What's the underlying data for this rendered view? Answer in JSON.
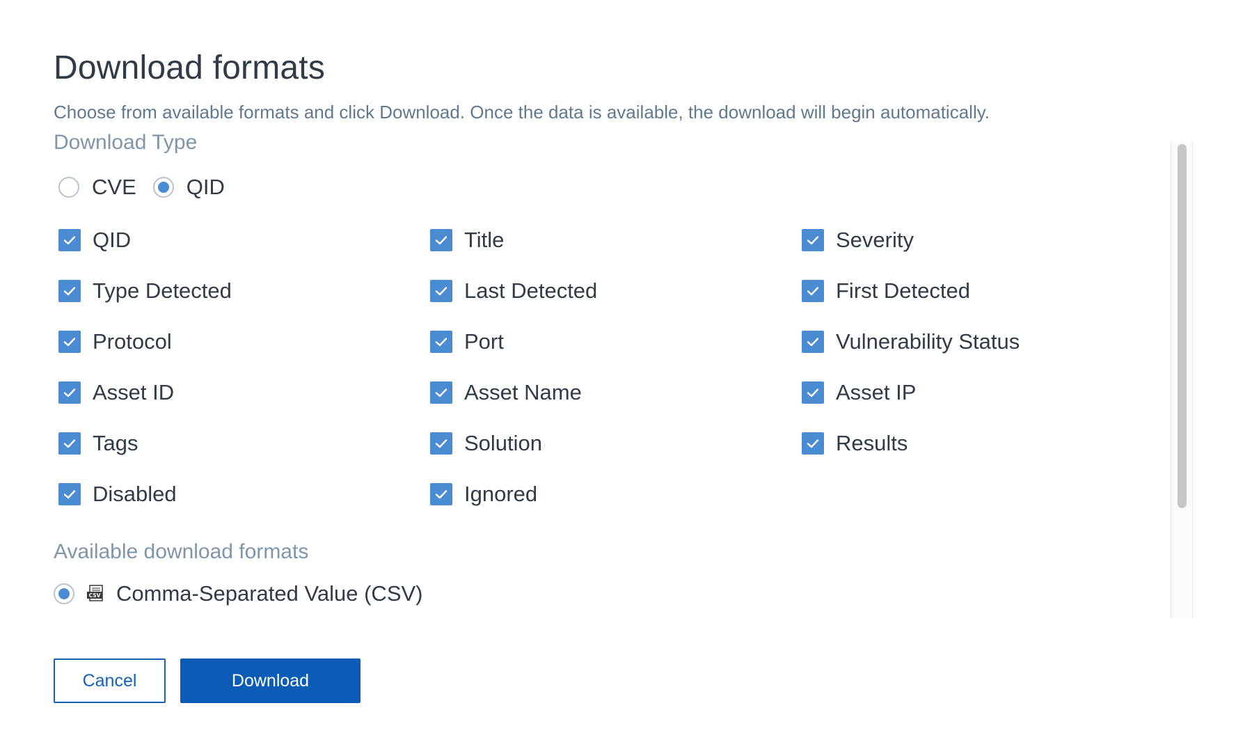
{
  "dialog": {
    "title": "Download formats",
    "subtitle": "Choose from available formats and click Download. Once the data is available, the download will begin automatically."
  },
  "download_type": {
    "label": "Download Type",
    "options": [
      {
        "label": "CVE",
        "checked": false
      },
      {
        "label": "QID",
        "checked": true
      }
    ]
  },
  "fields": [
    {
      "label": "QID",
      "checked": true
    },
    {
      "label": "Title",
      "checked": true
    },
    {
      "label": "Severity",
      "checked": true
    },
    {
      "label": "Type Detected",
      "checked": true
    },
    {
      "label": "Last Detected",
      "checked": true
    },
    {
      "label": "First Detected",
      "checked": true
    },
    {
      "label": "Protocol",
      "checked": true
    },
    {
      "label": "Port",
      "checked": true
    },
    {
      "label": "Vulnerability Status",
      "checked": true
    },
    {
      "label": "Asset ID",
      "checked": true
    },
    {
      "label": "Asset Name",
      "checked": true
    },
    {
      "label": "Asset IP",
      "checked": true
    },
    {
      "label": "Tags",
      "checked": true
    },
    {
      "label": "Solution",
      "checked": true
    },
    {
      "label": "Results",
      "checked": true
    },
    {
      "label": "Disabled",
      "checked": true
    },
    {
      "label": "Ignored",
      "checked": true
    }
  ],
  "formats": {
    "label": "Available download formats",
    "options": [
      {
        "label": "Comma-Separated Value (CSV)",
        "icon": "csv-file-icon",
        "icon_text": "CSV",
        "checked": true
      }
    ]
  },
  "buttons": {
    "cancel": "Cancel",
    "download": "Download"
  },
  "colors": {
    "accent": "#4a8bd1",
    "primary_button": "#0b5cb6",
    "label_muted": "#7e96a8"
  }
}
